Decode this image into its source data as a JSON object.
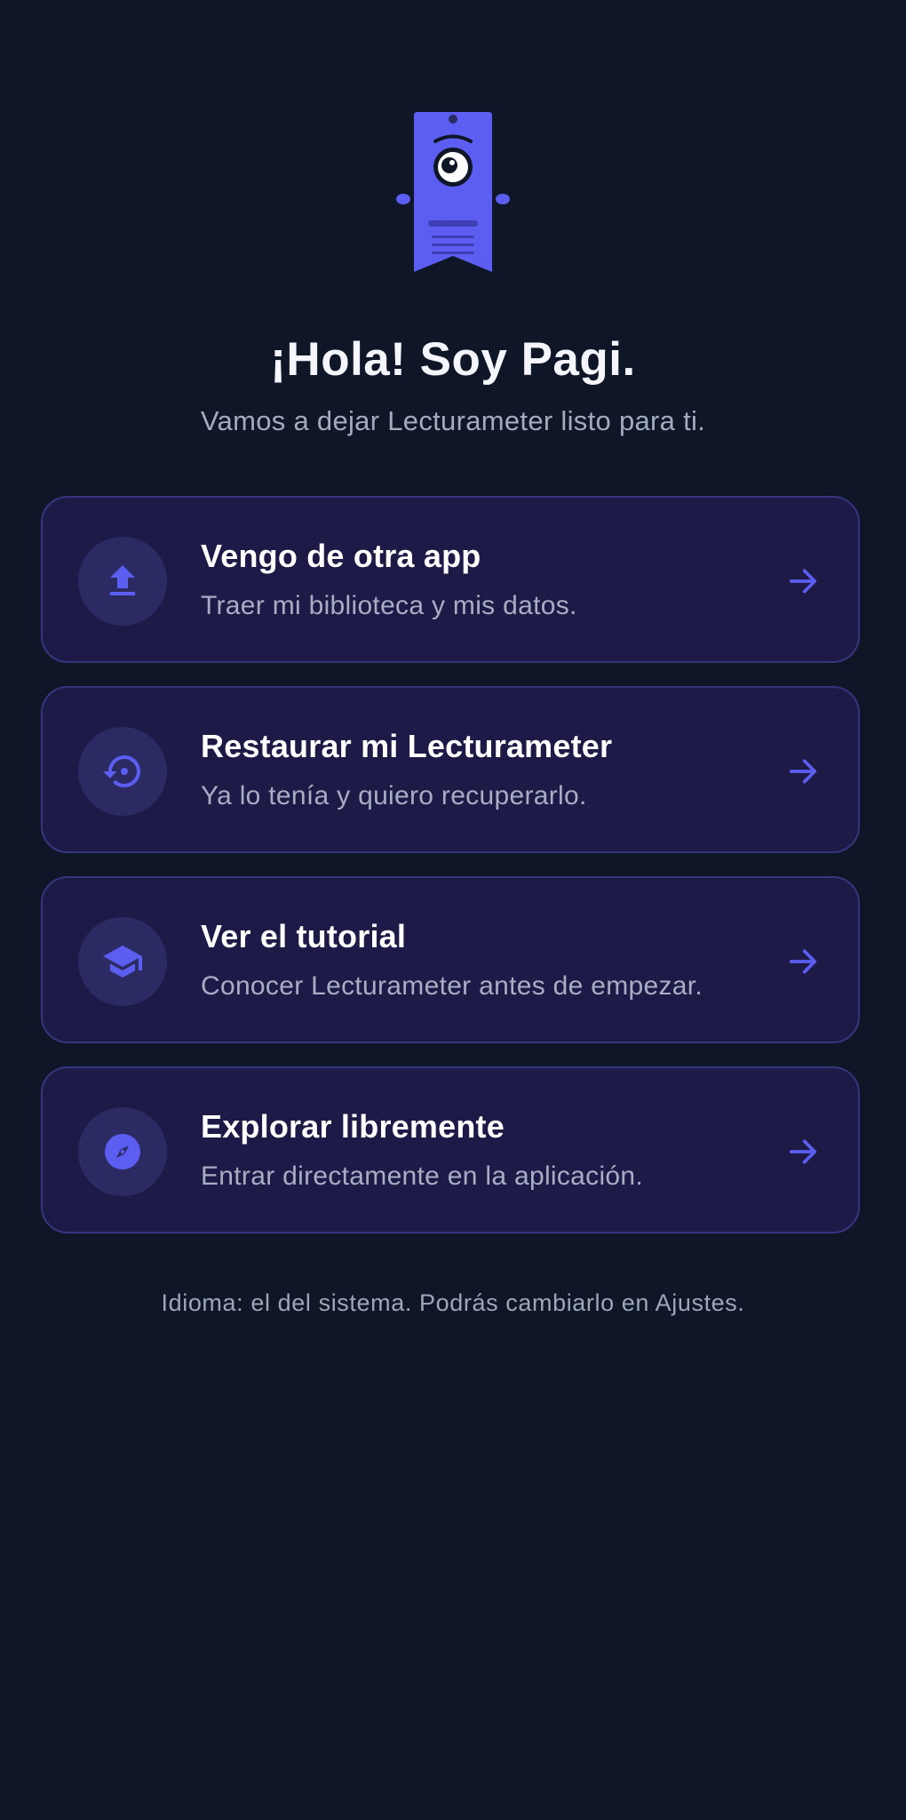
{
  "colors": {
    "background": "#0e1628",
    "card_background": "#1e1a48",
    "card_border": "#36357e",
    "accent": "#5b5ef0",
    "icon_circle": "#2c2a63"
  },
  "header": {
    "mascot_icon": "pagi-bookmark-mascot",
    "title": "¡Hola! Soy Pagi.",
    "subtitle": "Vamos a dejar Lecturameter listo para ti."
  },
  "options": [
    {
      "icon": "upload-icon",
      "title": "Vengo de otra app",
      "description": "Traer mi biblioteca y mis datos."
    },
    {
      "icon": "restore-icon",
      "title": "Restaurar mi Lecturameter",
      "description": "Ya lo tenía y quiero recuperarlo."
    },
    {
      "icon": "graduation-cap-icon",
      "title": "Ver el tutorial",
      "description": "Conocer Lecturameter antes de empezar."
    },
    {
      "icon": "compass-icon",
      "title": "Explorar libremente",
      "description": "Entrar directamente en la aplicación."
    }
  ],
  "footer": {
    "language_note": "Idioma: el del sistema. Podrás cambiarlo en Ajustes."
  }
}
